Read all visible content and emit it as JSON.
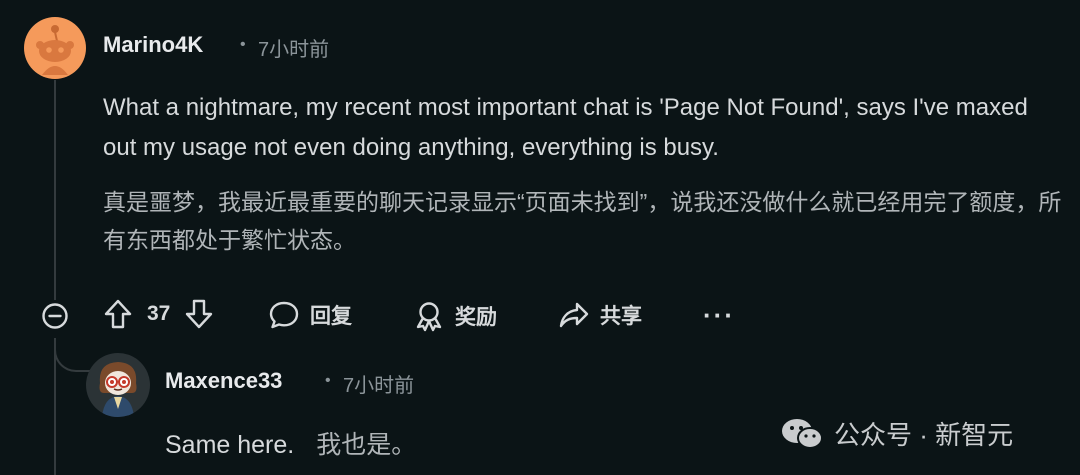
{
  "comment": {
    "username": "Marino4K",
    "separator": "•",
    "time": "7小时前",
    "body_en": "What a nightmare, my recent most important chat is 'Page Not Found', says I've maxed out my usage not even doing anything, everything is busy.",
    "body_cn": "真是噩梦，我最近最重要的聊天记录显示“页面未找到”，说我还没做什么就已经用完了额度，所有东西都处于繁忙状态。",
    "votes": "37",
    "reply_label": "回复",
    "award_label": "奖励",
    "share_label": "共享",
    "more_label": "···"
  },
  "reply": {
    "username": "Maxence33",
    "separator": "•",
    "time": "7小时前",
    "body_en": "Same here.",
    "body_cn": "我也是。"
  },
  "watermark": {
    "text": "公众号 · 新智元"
  },
  "colors": {
    "background": "#0b1416",
    "avatar_orange": "#f59a5b",
    "text": "#d7dadc",
    "muted": "#8b9499"
  }
}
